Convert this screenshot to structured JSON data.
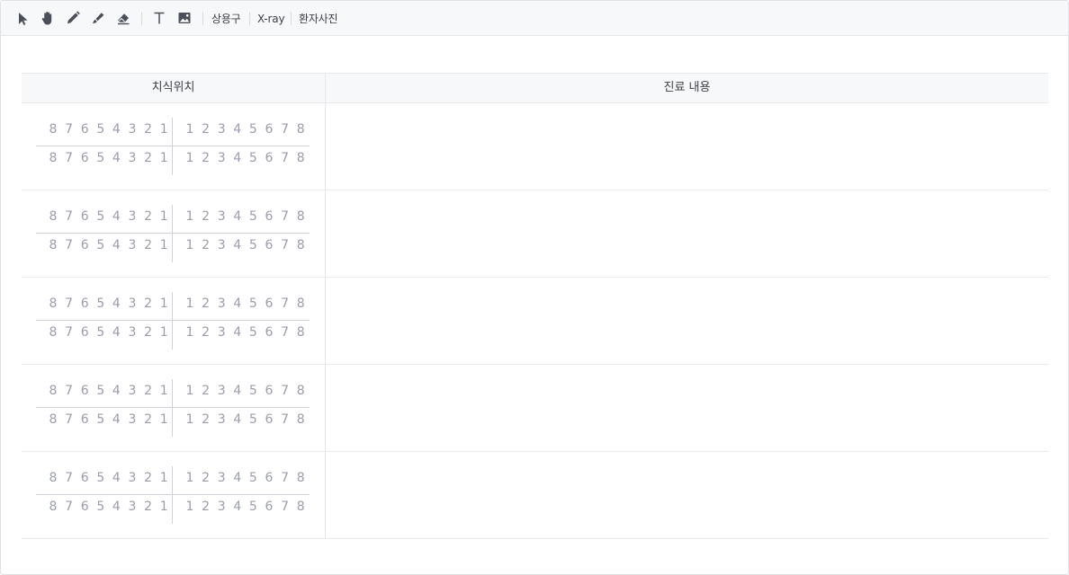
{
  "toolbar": {
    "tools": [
      {
        "icon": "pointer-icon"
      },
      {
        "icon": "hand-icon"
      },
      {
        "icon": "pencil-icon"
      },
      {
        "icon": "highlighter-icon"
      },
      {
        "icon": "eraser-icon"
      },
      {
        "icon": "text-icon"
      },
      {
        "icon": "image-icon"
      }
    ],
    "labels": {
      "phrases": "상용구",
      "xray": "X-ray",
      "patient_photo": "환자사진"
    }
  },
  "table": {
    "headers": {
      "tooth_position": "치식위치",
      "treatment_content": "진료 내용"
    },
    "rows": [
      {
        "upper_right": [
          "8",
          "7",
          "6",
          "5",
          "4",
          "3",
          "2",
          "1"
        ],
        "upper_left": [
          "1",
          "2",
          "3",
          "4",
          "5",
          "6",
          "7",
          "8"
        ],
        "lower_right": [
          "8",
          "7",
          "6",
          "5",
          "4",
          "3",
          "2",
          "1"
        ],
        "lower_left": [
          "1",
          "2",
          "3",
          "4",
          "5",
          "6",
          "7",
          "8"
        ],
        "content": ""
      },
      {
        "upper_right": [
          "8",
          "7",
          "6",
          "5",
          "4",
          "3",
          "2",
          "1"
        ],
        "upper_left": [
          "1",
          "2",
          "3",
          "4",
          "5",
          "6",
          "7",
          "8"
        ],
        "lower_right": [
          "8",
          "7",
          "6",
          "5",
          "4",
          "3",
          "2",
          "1"
        ],
        "lower_left": [
          "1",
          "2",
          "3",
          "4",
          "5",
          "6",
          "7",
          "8"
        ],
        "content": ""
      },
      {
        "upper_right": [
          "8",
          "7",
          "6",
          "5",
          "4",
          "3",
          "2",
          "1"
        ],
        "upper_left": [
          "1",
          "2",
          "3",
          "4",
          "5",
          "6",
          "7",
          "8"
        ],
        "lower_right": [
          "8",
          "7",
          "6",
          "5",
          "4",
          "3",
          "2",
          "1"
        ],
        "lower_left": [
          "1",
          "2",
          "3",
          "4",
          "5",
          "6",
          "7",
          "8"
        ],
        "content": ""
      },
      {
        "upper_right": [
          "8",
          "7",
          "6",
          "5",
          "4",
          "3",
          "2",
          "1"
        ],
        "upper_left": [
          "1",
          "2",
          "3",
          "4",
          "5",
          "6",
          "7",
          "8"
        ],
        "lower_right": [
          "8",
          "7",
          "6",
          "5",
          "4",
          "3",
          "2",
          "1"
        ],
        "lower_left": [
          "1",
          "2",
          "3",
          "4",
          "5",
          "6",
          "7",
          "8"
        ],
        "content": ""
      },
      {
        "upper_right": [
          "8",
          "7",
          "6",
          "5",
          "4",
          "3",
          "2",
          "1"
        ],
        "upper_left": [
          "1",
          "2",
          "3",
          "4",
          "5",
          "6",
          "7",
          "8"
        ],
        "lower_right": [
          "8",
          "7",
          "6",
          "5",
          "4",
          "3",
          "2",
          "1"
        ],
        "lower_left": [
          "1",
          "2",
          "3",
          "4",
          "5",
          "6",
          "7",
          "8"
        ],
        "content": ""
      }
    ]
  },
  "colors": {
    "toolbar_bg": "#f7f8fa",
    "icon": "#4a4f5a",
    "tooth_number": "#9a9eab",
    "grid_line": "#cfd2d9"
  }
}
